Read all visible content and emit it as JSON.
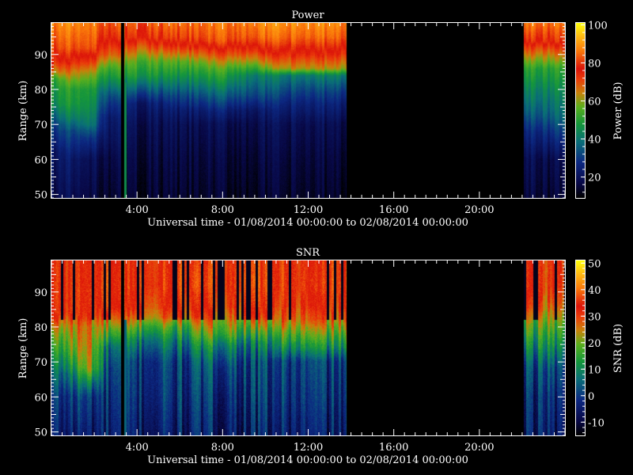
{
  "chart_data": [
    {
      "type": "heatmap",
      "title": "Power",
      "xlabel": "Universal time - 01/08/2014 00:00:00 to 02/08/2014 00:00:00",
      "ylabel": "Range (km)",
      "colorbar_label": "Power (dB)",
      "x_ticks": [
        "4:00",
        "8:00",
        "12:00",
        "16:00",
        "20:00"
      ],
      "x_tick_hours": [
        4,
        8,
        12,
        16,
        20
      ],
      "y_ticks": [
        50,
        60,
        70,
        80,
        90
      ],
      "xlim_hours": [
        0,
        24
      ],
      "ylim_km": [
        49,
        99
      ],
      "colorbar_ticks": [
        20,
        40,
        60,
        80,
        100
      ],
      "colorbar_range": [
        9,
        101
      ],
      "data_gaps_hours": [
        [
          13.8,
          22.1
        ],
        [
          3.25,
          3.4
        ]
      ],
      "column_spikes": [
        {
          "hour": 3.45,
          "value_db": 45
        }
      ],
      "profiles": [
        {
          "hour": 0.0,
          "points": [
            [
              49,
              18
            ],
            [
              62,
              22
            ],
            [
              70,
              32
            ],
            [
              76,
              45
            ],
            [
              80,
              48
            ],
            [
              83,
              52
            ],
            [
              85,
              65
            ],
            [
              88,
              75
            ],
            [
              92,
              82
            ],
            [
              99,
              88
            ]
          ]
        },
        {
          "hour": 1.0,
          "points": [
            [
              49,
              18
            ],
            [
              60,
              22
            ],
            [
              68,
              32
            ],
            [
              72,
              42
            ],
            [
              76,
              48
            ],
            [
              80,
              50
            ],
            [
              84,
              62
            ],
            [
              88,
              74
            ],
            [
              92,
              82
            ],
            [
              99,
              88
            ]
          ]
        },
        {
          "hour": 1.8,
          "points": [
            [
              49,
              15
            ],
            [
              60,
              18
            ],
            [
              66,
              28
            ],
            [
              70,
              40
            ],
            [
              74,
              44
            ],
            [
              80,
              48
            ],
            [
              84,
              58
            ],
            [
              88,
              72
            ],
            [
              92,
              82
            ],
            [
              99,
              86
            ]
          ]
        },
        {
          "hour": 2.6,
          "points": [
            [
              49,
              15
            ],
            [
              60,
              18
            ],
            [
              66,
              22
            ],
            [
              72,
              25
            ],
            [
              78,
              35
            ],
            [
              82,
              45
            ],
            [
              86,
              55
            ],
            [
              90,
              70
            ],
            [
              95,
              80
            ],
            [
              99,
              84
            ]
          ]
        },
        {
          "hour": 4.0,
          "points": [
            [
              49,
              13
            ],
            [
              60,
              15
            ],
            [
              70,
              18
            ],
            [
              76,
              22
            ],
            [
              80,
              35
            ],
            [
              84,
              48
            ],
            [
              88,
              55
            ],
            [
              92,
              68
            ],
            [
              95,
              78
            ],
            [
              99,
              82
            ]
          ]
        },
        {
          "hour": 6.0,
          "points": [
            [
              49,
              13
            ],
            [
              60,
              15
            ],
            [
              70,
              18
            ],
            [
              74,
              22
            ],
            [
              78,
              30
            ],
            [
              84,
              45
            ],
            [
              88,
              55
            ],
            [
              92,
              72
            ],
            [
              95,
              80
            ],
            [
              99,
              84
            ]
          ]
        },
        {
          "hour": 8.0,
          "points": [
            [
              49,
              13
            ],
            [
              60,
              15
            ],
            [
              70,
              18
            ],
            [
              74,
              25
            ],
            [
              78,
              35
            ],
            [
              82,
              45
            ],
            [
              86,
              55
            ],
            [
              90,
              70
            ],
            [
              94,
              82
            ],
            [
              99,
              86
            ]
          ]
        },
        {
          "hour": 9.5,
          "points": [
            [
              49,
              13
            ],
            [
              60,
              15
            ],
            [
              70,
              18
            ],
            [
              74,
              22
            ],
            [
              78,
              32
            ],
            [
              84,
              42
            ],
            [
              88,
              62
            ],
            [
              91,
              74
            ],
            [
              95,
              84
            ],
            [
              99,
              88
            ]
          ]
        },
        {
          "hour": 11.0,
          "points": [
            [
              49,
              13
            ],
            [
              60,
              15
            ],
            [
              70,
              18
            ],
            [
              76,
              25
            ],
            [
              80,
              32
            ],
            [
              84,
              40
            ],
            [
              86,
              62
            ],
            [
              90,
              74
            ],
            [
              95,
              84
            ],
            [
              99,
              88
            ]
          ]
        },
        {
          "hour": 13.8,
          "points": [
            [
              49,
              13
            ],
            [
              60,
              15
            ],
            [
              70,
              18
            ],
            [
              76,
              25
            ],
            [
              80,
              32
            ],
            [
              84,
              42
            ],
            [
              86,
              62
            ],
            [
              90,
              74
            ],
            [
              95,
              84
            ],
            [
              99,
              88
            ]
          ]
        },
        {
          "hour": 22.1,
          "points": [
            [
              49,
              15
            ],
            [
              60,
              18
            ],
            [
              68,
              25
            ],
            [
              74,
              35
            ],
            [
              80,
              42
            ],
            [
              86,
              50
            ],
            [
              90,
              64
            ],
            [
              94,
              78
            ],
            [
              99,
              86
            ]
          ]
        },
        {
          "hour": 24.0,
          "points": [
            [
              49,
              15
            ],
            [
              60,
              18
            ],
            [
              66,
              28
            ],
            [
              72,
              38
            ],
            [
              80,
              45
            ],
            [
              86,
              52
            ],
            [
              90,
              66
            ],
            [
              94,
              80
            ],
            [
              99,
              86
            ]
          ]
        }
      ]
    },
    {
      "type": "heatmap",
      "title": "SNR",
      "xlabel": "Universal time - 01/08/2014 00:00:00 to 02/08/2014 00:00:00",
      "ylabel": "Range (km)",
      "colorbar_label": "SNR (dB)",
      "x_ticks": [
        "4:00",
        "8:00",
        "12:00",
        "16:00",
        "20:00"
      ],
      "x_tick_hours": [
        4,
        8,
        12,
        16,
        20
      ],
      "y_ticks": [
        50,
        60,
        70,
        80,
        90
      ],
      "xlim_hours": [
        0,
        24
      ],
      "ylim_km": [
        49,
        99
      ],
      "colorbar_ticks": [
        -10,
        0,
        10,
        20,
        30,
        40,
        50
      ],
      "colorbar_range": [
        -15,
        51
      ],
      "data_gaps_hours": [
        [
          13.8,
          22.1
        ],
        [
          3.25,
          3.4
        ]
      ],
      "column_spikes": [
        {
          "hour": 3.45,
          "value_db": 5
        }
      ],
      "profiles": [
        {
          "hour": 0.0,
          "points": [
            [
              49,
              -5
            ],
            [
              60,
              -2
            ],
            [
              68,
              5
            ],
            [
              74,
              12
            ],
            [
              78,
              18
            ],
            [
              81,
              25
            ],
            [
              84,
              32
            ],
            [
              90,
              33
            ],
            [
              99,
              32
            ]
          ]
        },
        {
          "hour": 1.0,
          "points": [
            [
              49,
              -5
            ],
            [
              60,
              0
            ],
            [
              66,
              8
            ],
            [
              70,
              15
            ],
            [
              74,
              20
            ],
            [
              80,
              25
            ],
            [
              84,
              32
            ],
            [
              90,
              33
            ],
            [
              99,
              32
            ]
          ]
        },
        {
          "hour": 1.8,
          "points": [
            [
              49,
              -5
            ],
            [
              60,
              0
            ],
            [
              64,
              10
            ],
            [
              68,
              22
            ],
            [
              74,
              25
            ],
            [
              80,
              26
            ],
            [
              84,
              32
            ],
            [
              90,
              33
            ],
            [
              99,
              32
            ]
          ]
        },
        {
          "hour": 2.6,
          "points": [
            [
              49,
              -5
            ],
            [
              60,
              -3
            ],
            [
              68,
              0
            ],
            [
              74,
              5
            ],
            [
              78,
              15
            ],
            [
              82,
              24
            ],
            [
              86,
              32
            ],
            [
              92,
              33
            ],
            [
              99,
              32
            ]
          ]
        },
        {
          "hour": 4.0,
          "points": [
            [
              49,
              -5
            ],
            [
              60,
              -2
            ],
            [
              70,
              0
            ],
            [
              76,
              8
            ],
            [
              80,
              18
            ],
            [
              83,
              26
            ],
            [
              86,
              30
            ],
            [
              92,
              33
            ],
            [
              99,
              32
            ]
          ]
        },
        {
          "hour": 6.0,
          "points": [
            [
              49,
              -5
            ],
            [
              60,
              -2
            ],
            [
              70,
              0
            ],
            [
              76,
              8
            ],
            [
              80,
              16
            ],
            [
              83,
              26
            ],
            [
              86,
              30
            ],
            [
              92,
              33
            ],
            [
              99,
              32
            ]
          ]
        },
        {
          "hour": 8.0,
          "points": [
            [
              49,
              -5
            ],
            [
              60,
              -2
            ],
            [
              68,
              2
            ],
            [
              74,
              10
            ],
            [
              78,
              20
            ],
            [
              82,
              25
            ],
            [
              86,
              30
            ],
            [
              92,
              33
            ],
            [
              99,
              32
            ]
          ]
        },
        {
          "hour": 9.5,
          "points": [
            [
              49,
              -5
            ],
            [
              60,
              -2
            ],
            [
              70,
              0
            ],
            [
              76,
              8
            ],
            [
              80,
              18
            ],
            [
              83,
              26
            ],
            [
              86,
              30
            ],
            [
              92,
              33
            ],
            [
              99,
              32
            ]
          ]
        },
        {
          "hour": 11.0,
          "points": [
            [
              49,
              -5
            ],
            [
              60,
              -2
            ],
            [
              70,
              0
            ],
            [
              74,
              10
            ],
            [
              78,
              18
            ],
            [
              82,
              26
            ],
            [
              86,
              30
            ],
            [
              92,
              33
            ],
            [
              99,
              32
            ]
          ]
        },
        {
          "hour": 13.8,
          "points": [
            [
              49,
              -5
            ],
            [
              60,
              -2
            ],
            [
              70,
              0
            ],
            [
              74,
              10
            ],
            [
              78,
              18
            ],
            [
              82,
              26
            ],
            [
              86,
              30
            ],
            [
              92,
              33
            ],
            [
              99,
              32
            ]
          ]
        },
        {
          "hour": 22.1,
          "points": [
            [
              49,
              -5
            ],
            [
              60,
              -3
            ],
            [
              68,
              0
            ],
            [
              74,
              8
            ],
            [
              80,
              16
            ],
            [
              86,
              25
            ],
            [
              92,
              30
            ],
            [
              99,
              30
            ]
          ]
        },
        {
          "hour": 24.0,
          "points": [
            [
              49,
              -5
            ],
            [
              60,
              -2
            ],
            [
              68,
              2
            ],
            [
              74,
              10
            ],
            [
              80,
              18
            ],
            [
              86,
              26
            ],
            [
              92,
              30
            ],
            [
              99,
              30
            ]
          ]
        }
      ]
    }
  ]
}
